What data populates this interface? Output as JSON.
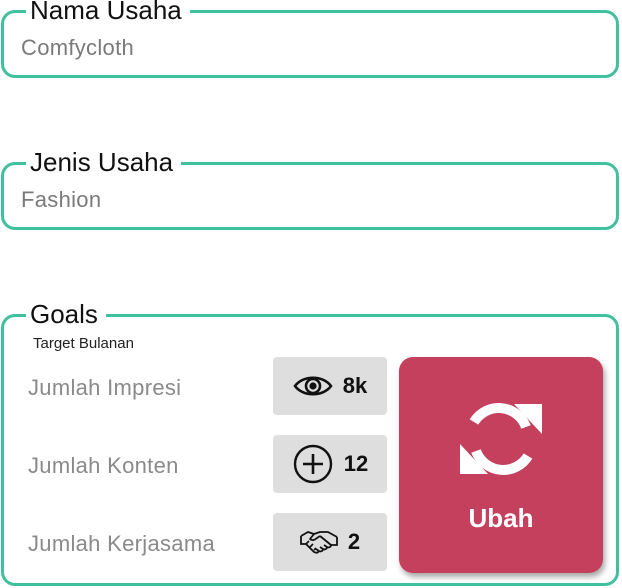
{
  "business_name": {
    "label": "Nama Usaha",
    "value": "Comfycloth"
  },
  "business_type": {
    "label": "Jenis Usaha",
    "value": "Fashion"
  },
  "goals": {
    "label": "Goals",
    "subtitle": "Target Bulanan",
    "items": [
      {
        "label": "Jumlah Impresi",
        "value": "8k",
        "icon": "eye-icon"
      },
      {
        "label": "Jumlah Konten",
        "value": "12",
        "icon": "plus-circle-icon"
      },
      {
        "label": "Jumlah Kerjasama",
        "value": "2",
        "icon": "handshake-icon"
      }
    ],
    "edit_button": {
      "label": "Ubah",
      "icon": "refresh-icon",
      "color": "#c4405c"
    }
  },
  "colors": {
    "border": "#3fc1a0",
    "pill_bg": "#dedede"
  }
}
